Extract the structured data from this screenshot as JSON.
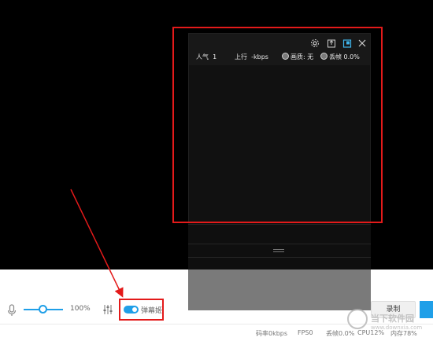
{
  "panel": {
    "popularity_label": "人气",
    "popularity_value": "1",
    "upload_label": "上行",
    "upload_value": "-kbps",
    "picture_label": "画质: 无",
    "drop_label": "丢帧 0.0%",
    "icons": [
      "gear-icon",
      "export-icon",
      "popout-icon",
      "close-icon"
    ]
  },
  "controls": {
    "volume_percent": "100%",
    "volume_level": 1.0,
    "danmu_label": "弹幕姬",
    "record_label": "录制"
  },
  "status": {
    "bitrate": "码率0kbps",
    "fps": "FPS0",
    "drop": "丢帧0.0%",
    "cpu": "CPU12%",
    "memory": "内存78%"
  },
  "watermark": {
    "title": "当下软件园",
    "url": "www.downxia.com"
  },
  "colors": {
    "annotation_red": "#e31a1a",
    "accent_blue": "#1f9fe8"
  }
}
